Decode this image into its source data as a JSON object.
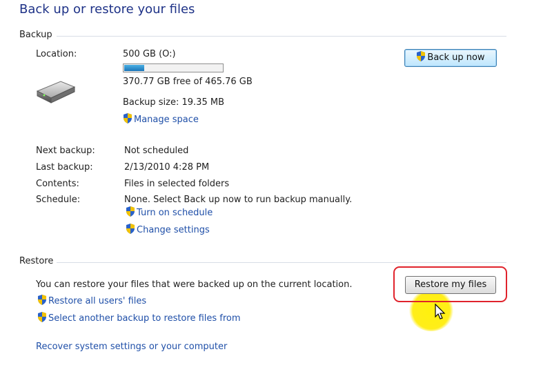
{
  "page": {
    "title": "Back up or restore your files"
  },
  "backup": {
    "section_label": "Backup",
    "location_label": "Location:",
    "location_value": "500 GB (O:)",
    "free_space": "370.77 GB free of 465.76 GB",
    "used_fraction": 0.2,
    "backup_size": "Backup size: 19.35 MB",
    "manage_space_link": "Manage space",
    "back_up_now_button": "Back up now",
    "next_backup_label": "Next backup:",
    "next_backup_value": "Not scheduled",
    "last_backup_label": "Last backup:",
    "last_backup_value": "2/13/2010 4:28 PM",
    "contents_label": "Contents:",
    "contents_value": "Files in selected folders",
    "schedule_label": "Schedule:",
    "schedule_value": "None. Select Back up now to run backup manually.",
    "turn_on_schedule_link": "Turn on schedule",
    "change_settings_link": "Change settings"
  },
  "restore": {
    "section_label": "Restore",
    "description": "You can restore your files that were backed up on the current location.",
    "restore_my_files_button": "Restore my files",
    "restore_all_users_link": "Restore all users' files",
    "select_another_backup_link": "Select another backup to restore files from",
    "recover_system_link": "Recover system settings or your computer"
  },
  "colors": {
    "title": "#1e3287",
    "link": "#1f4fa8",
    "highlight": "#e0222b"
  }
}
